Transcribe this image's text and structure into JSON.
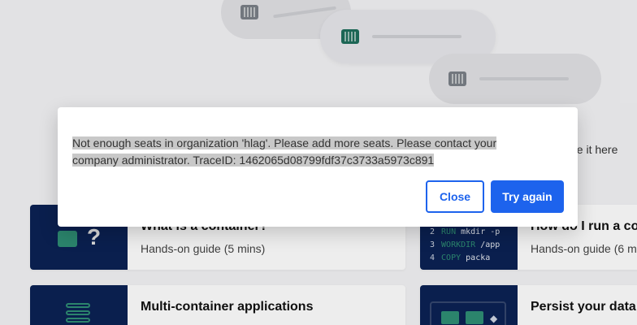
{
  "background": {
    "see_here_text": "ee it here",
    "cards": [
      {
        "title": "What is a container?",
        "subtitle": "Hands-on guide (5 mins)"
      },
      {
        "title": "How do I run a con",
        "subtitle": "Hands-on guide (6 m"
      },
      {
        "title": "Multi-container applications",
        "subtitle": ""
      },
      {
        "title": "Persist your data b",
        "subtitle": ""
      }
    ],
    "code_lines": [
      {
        "num": "2",
        "kw": "RUN",
        "text": "mkdir -p"
      },
      {
        "num": "3",
        "kw": "WORKDIR",
        "text": "/app"
      },
      {
        "num": "4",
        "kw": "COPY",
        "text": "packa"
      }
    ]
  },
  "modal": {
    "message": "Not enough seats in organization 'hlag'. Please add more seats. Please contact your company administrator. TraceID: 1462065d08799fdf37c3733a5973c891",
    "close_label": "Close",
    "retry_label": "Try again"
  },
  "colors": {
    "primary": "#1d63ed",
    "thumb_bg": "#0b2254",
    "accent_green": "#2f8f75"
  }
}
